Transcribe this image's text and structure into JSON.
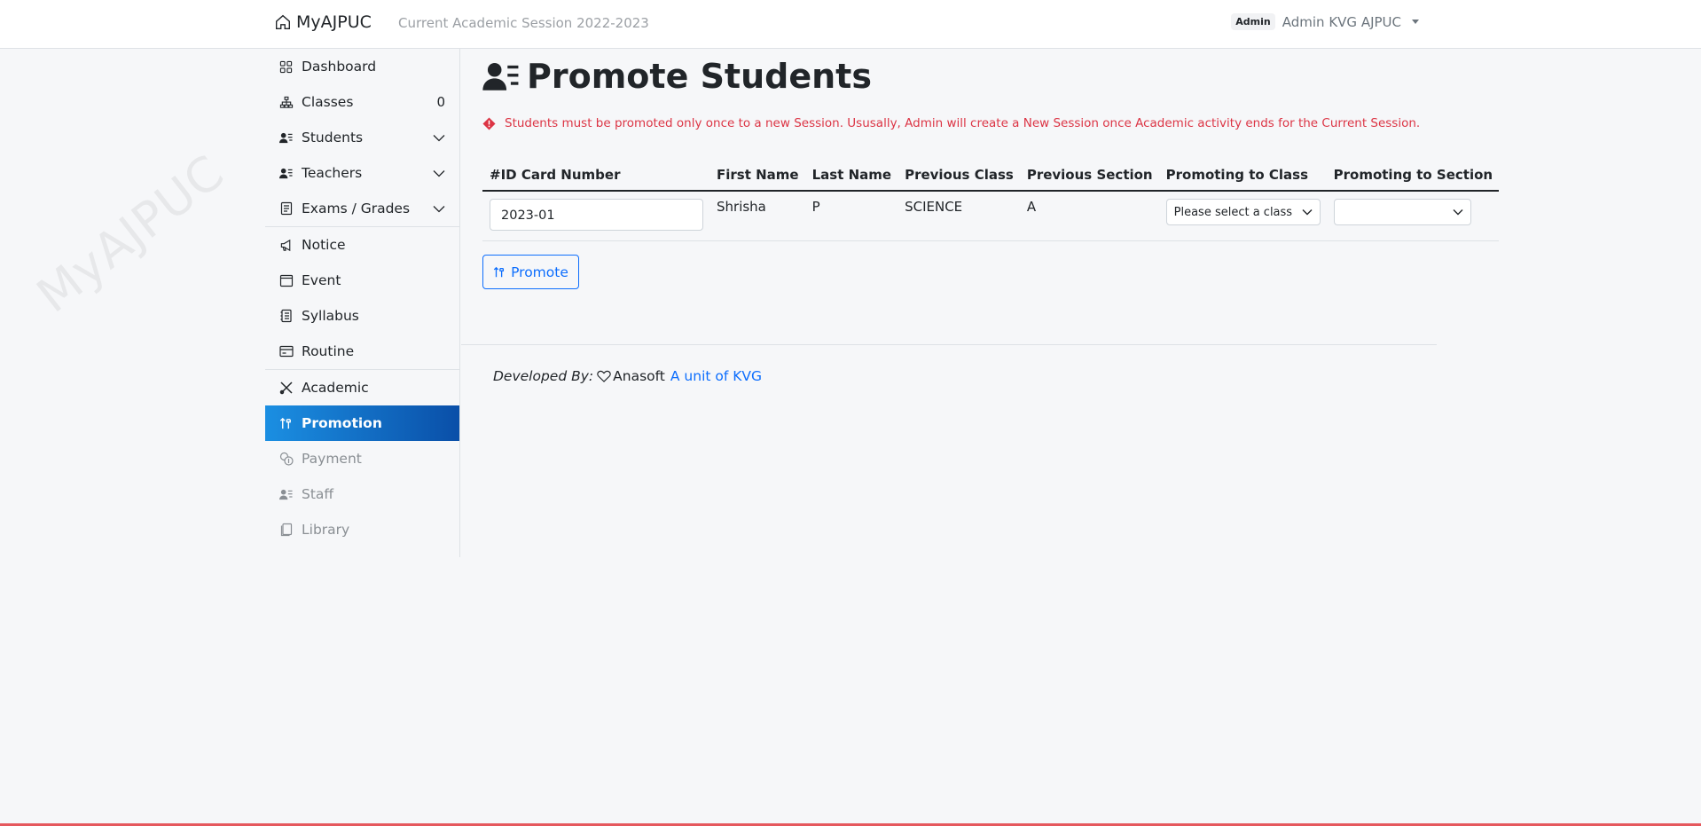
{
  "header": {
    "brand": "MyAJPUC",
    "session": "Current Academic Session 2022-2023",
    "role_badge": "Admin",
    "user_name": "Admin KVG AJPUC"
  },
  "watermark": "MyAJPUC",
  "sidebar": {
    "groups": [
      [
        {
          "label": "Dashboard",
          "icon": "grid-icon"
        },
        {
          "label": "Classes",
          "icon": "diagram-icon",
          "count": "0"
        },
        {
          "label": "Students",
          "icon": "person-lines-icon",
          "chevron": true
        },
        {
          "label": "Teachers",
          "icon": "person-lines-icon",
          "chevron": true
        },
        {
          "label": "Exams / Grades",
          "icon": "clipboard-icon",
          "chevron": true
        }
      ],
      [
        {
          "label": "Notice",
          "icon": "megaphone-icon"
        },
        {
          "label": "Event",
          "icon": "calendar-icon"
        },
        {
          "label": "Syllabus",
          "icon": "journal-icon"
        },
        {
          "label": "Routine",
          "icon": "credit-card-icon"
        }
      ],
      [
        {
          "label": "Academic",
          "icon": "tools-icon"
        },
        {
          "label": "Promotion",
          "icon": "sort-up-icon",
          "active": true
        },
        {
          "label": "Payment",
          "icon": "coin-icon",
          "disabled": true
        },
        {
          "label": "Staff",
          "icon": "person-lines-icon",
          "disabled": true
        },
        {
          "label": "Library",
          "icon": "journals-icon",
          "disabled": true
        }
      ]
    ]
  },
  "main": {
    "title": "Promote Students",
    "alert": "Students must be promoted only once to a new Session. Ususally, Admin will create a New Session once Academic activity ends for the Current Session.",
    "table": {
      "headers": [
        "#ID Card Number",
        "First Name",
        "Last Name",
        "Previous Class",
        "Previous Section",
        "Promoting to Class",
        "Promoting to Section"
      ],
      "rows": [
        {
          "id_card": "2023-01",
          "first_name": "Shrisha",
          "last_name": "P",
          "previous_class": "SCIENCE",
          "previous_section": "A",
          "promoting_class": "Please select a class",
          "promoting_section": ""
        }
      ]
    },
    "promote_button": "Promote"
  },
  "footer": {
    "developed_by": "Developed By:",
    "company": "Anasoft",
    "link": "A unit of KVG"
  },
  "colors": {
    "active_gradient_start": "#1b8fe2",
    "active_gradient_end": "#0a4fa8",
    "alert": "#dc3545",
    "link": "#0d6efd",
    "bottom_line": "#e5585d"
  }
}
